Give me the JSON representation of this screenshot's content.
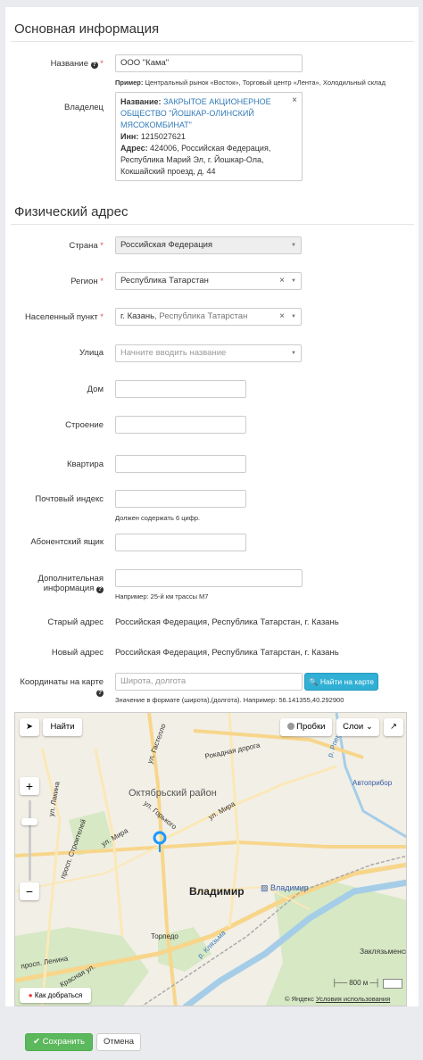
{
  "sections": {
    "basic": "Основная информация",
    "physical": "Физический адрес"
  },
  "fields": {
    "name": {
      "label": "Название",
      "value": "ООО \"Кама\""
    },
    "name_hint_prefix": "Пример:",
    "name_hint": "Центральный рынок «Восток», Торговый центр «Лента», Холодильный склад",
    "owner": {
      "label": "Владелец",
      "name_label": "Название:",
      "name_value": "ЗАКРЫТОЕ АКЦИОНЕРНОЕ ОБЩЕСТВО \"ЙОШКАР-ОЛИНСКИЙ МЯСОКОМБИНАТ\"",
      "inn_label": "Инн:",
      "inn_value": "1215027621",
      "address_label": "Адрес:",
      "address_value": "424006, Российская Федерация, Республика Марий Эл, г. Йошкар-Ола, Кокшайский проезд, д. 44"
    },
    "country": {
      "label": "Страна",
      "value": "Российская Федерация"
    },
    "region": {
      "label": "Регион",
      "value": "Республика Татарстан"
    },
    "city": {
      "label": "Населенный пункт",
      "value_main": "г. Казань",
      "value_sub": ", Республика Татарстан"
    },
    "street": {
      "label": "Улица",
      "placeholder": "Начните вводить название"
    },
    "house": {
      "label": "Дом"
    },
    "building": {
      "label": "Строение"
    },
    "apartment": {
      "label": "Квартира"
    },
    "postal": {
      "label": "Почтовый индекс",
      "hint": "Должен содержать 6 цифр."
    },
    "pobox": {
      "label": "Абонентский ящик"
    },
    "extra": {
      "label_line1": "Дополнительная",
      "label_line2": "информация",
      "hint": "Например: 25-й км трассы М7"
    },
    "old_address": {
      "label": "Старый адрес",
      "value": "Российская Федерация, Республика Татарстан, г. Казань"
    },
    "new_address": {
      "label": "Новый адрес",
      "value": "Российская Федерация, Республика Татарстан, г. Казань"
    },
    "coords": {
      "label": "Координаты на карте",
      "placeholder": "Широта, долгота",
      "button": "Найти на карте",
      "hint": "Значение в формате (широта),(долгота). Например: 56.141355,40.292900"
    }
  },
  "map": {
    "find_button": "Найти",
    "traffic_button": "Пробки",
    "layers_button": "Слои",
    "route_link": "Как добраться",
    "scale": "800 м",
    "copyright": "© Яндекс",
    "terms": "Условия использования",
    "labels": {
      "district": "Октябрьский район",
      "city": "Владимир",
      "station": "Владимир",
      "torpedo": "Торпедо",
      "avtopribor": "Автоприбор",
      "zaklyazmensky": "Заклязьменск",
      "gastello": "ул. Гастелло",
      "rokadnaya": "Рокадная дорога",
      "gorkogo": "ул. Горького",
      "mira1": "ул. Мира",
      "mira2": "ул. Мира",
      "lakina": "ул. Лакина",
      "stroiteley": "просп. Строителей",
      "lenina": "просп. Ленина",
      "krasnaya": "Красная ул.",
      "klyazma": "р. Клязьма",
      "rpechn": "р. Рпень"
    }
  },
  "actions": {
    "save": "Сохранить",
    "cancel": "Отмена"
  },
  "colors": {
    "required": "#d9534f",
    "link": "#337ab7",
    "info_button": "#31b0d5",
    "save_button": "#5cb85c",
    "map_marker": "#1e98ff"
  }
}
